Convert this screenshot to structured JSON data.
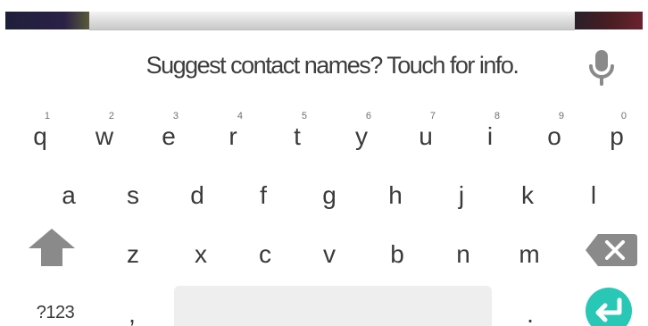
{
  "suggestion": {
    "text": "Suggest contact names? Touch for info."
  },
  "icons": {
    "mic": "microphone-icon",
    "shift": "shift-arrow-icon",
    "backspace": "backspace-icon",
    "enter": "enter-icon"
  },
  "colors": {
    "text": "#3a3a3a",
    "hint": "#707070",
    "icon_gray": "#8a8a8a",
    "enter_teal": "#29c7b6",
    "space_bg": "#eeeeee"
  },
  "keyboard": {
    "row1": [
      {
        "key": "q",
        "hint": "1"
      },
      {
        "key": "w",
        "hint": "2"
      },
      {
        "key": "e",
        "hint": "3"
      },
      {
        "key": "r",
        "hint": "4"
      },
      {
        "key": "t",
        "hint": "5"
      },
      {
        "key": "y",
        "hint": "6"
      },
      {
        "key": "u",
        "hint": "7"
      },
      {
        "key": "i",
        "hint": "8"
      },
      {
        "key": "o",
        "hint": "9"
      },
      {
        "key": "p",
        "hint": "0"
      }
    ],
    "row2": [
      "a",
      "s",
      "d",
      "f",
      "g",
      "h",
      "j",
      "k",
      "l"
    ],
    "row3": [
      "z",
      "x",
      "c",
      "v",
      "b",
      "n",
      "m"
    ],
    "bottom": {
      "symbols_label": "?123",
      "comma_label": ",",
      "period_label": "."
    }
  }
}
